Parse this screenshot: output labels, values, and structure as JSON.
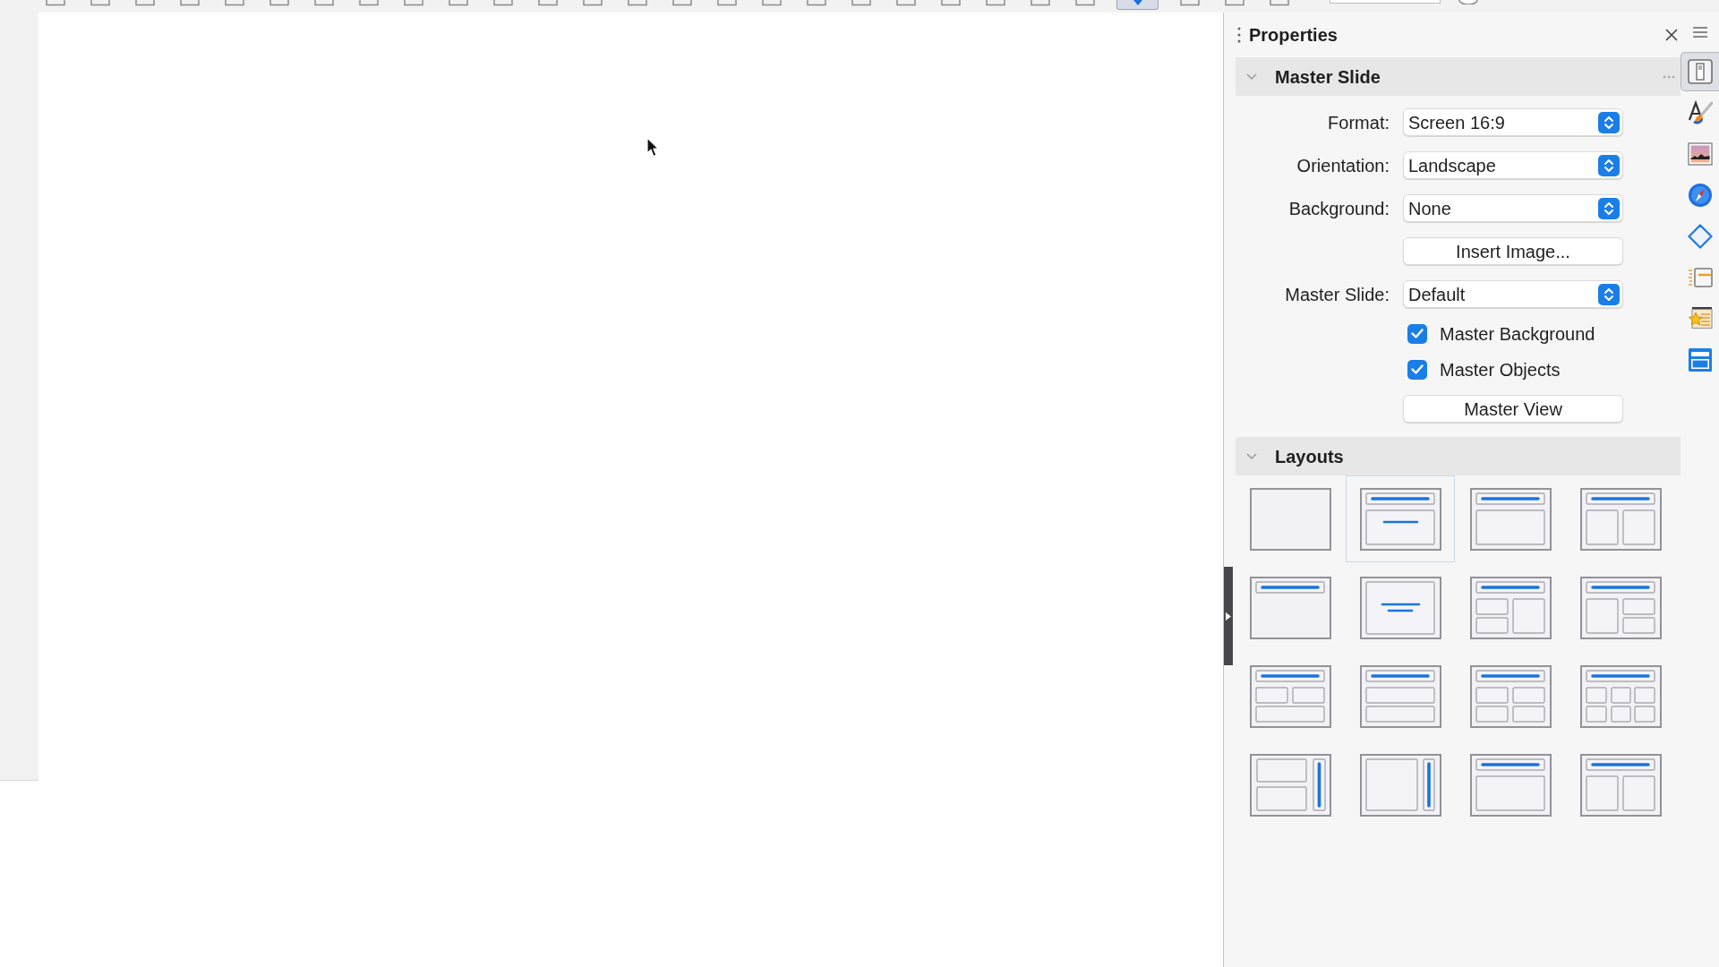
{
  "toolbar": {
    "items": [
      {
        "kind": "icon",
        "selected": false
      },
      {
        "kind": "icon",
        "selected": false
      },
      {
        "kind": "icon",
        "selected": false
      },
      {
        "kind": "icon",
        "selected": false
      },
      {
        "kind": "icon",
        "selected": false
      },
      {
        "kind": "icon",
        "selected": false
      },
      {
        "kind": "icon",
        "selected": false
      },
      {
        "kind": "icon",
        "selected": false
      },
      {
        "kind": "icon",
        "selected": false
      },
      {
        "kind": "icon",
        "selected": false
      },
      {
        "kind": "icon",
        "selected": false
      },
      {
        "kind": "icon",
        "selected": false
      },
      {
        "kind": "icon",
        "selected": false
      },
      {
        "kind": "icon",
        "selected": false
      },
      {
        "kind": "icon",
        "selected": false
      },
      {
        "kind": "icon",
        "selected": false
      },
      {
        "kind": "icon",
        "selected": false
      },
      {
        "kind": "icon",
        "selected": false
      },
      {
        "kind": "icon",
        "selected": false
      },
      {
        "kind": "icon",
        "selected": false
      },
      {
        "kind": "icon",
        "selected": false
      },
      {
        "kind": "icon",
        "selected": false
      },
      {
        "kind": "icon",
        "selected": false
      },
      {
        "kind": "icon",
        "selected": false
      },
      {
        "kind": "icon",
        "selected": true
      },
      {
        "kind": "icon",
        "selected": false
      },
      {
        "kind": "icon",
        "selected": false
      },
      {
        "kind": "icon",
        "selected": false
      },
      {
        "kind": "field"
      },
      {
        "kind": "knob"
      }
    ]
  },
  "sidebar": {
    "title": "Properties",
    "sections": [
      {
        "kind": "form",
        "title": "Master Slide",
        "expanded": true,
        "rows": [
          {
            "kind": "select",
            "label": "Format:",
            "value": "Screen 16:9"
          },
          {
            "kind": "select",
            "label": "Orientation:",
            "value": "Landscape"
          },
          {
            "kind": "select",
            "label": "Background:",
            "value": "None"
          },
          {
            "kind": "button",
            "label": "Insert Image..."
          },
          {
            "kind": "select",
            "label": "Master Slide:",
            "value": "Default"
          },
          {
            "kind": "checkbox",
            "label": "Master Background",
            "checked": true
          },
          {
            "kind": "checkbox",
            "label": "Master Objects",
            "checked": true
          },
          {
            "kind": "button",
            "label": "Master View"
          }
        ]
      },
      {
        "kind": "layouts",
        "title": "Layouts",
        "expanded": true,
        "layouts": [
          {
            "kind": "blank",
            "selected": false
          },
          {
            "kind": "title",
            "selected": true
          },
          {
            "kind": "content",
            "selected": false
          },
          {
            "kind": "twocontent",
            "selected": false
          },
          {
            "kind": "titleonly",
            "selected": false
          },
          {
            "kind": "centered",
            "selected": false
          },
          {
            "kind": "twoleft",
            "selected": false
          },
          {
            "kind": "tworight",
            "selected": false
          },
          {
            "kind": "twoover",
            "selected": false
          },
          {
            "kind": "stacked",
            "selected": false
          },
          {
            "kind": "four",
            "selected": false
          },
          {
            "kind": "six",
            "selected": false
          },
          {
            "kind": "verticalsplit",
            "selected": false
          },
          {
            "kind": "vertical",
            "selected": false
          },
          {
            "kind": "content",
            "selected": false
          },
          {
            "kind": "twocontent",
            "selected": false
          }
        ]
      }
    ]
  },
  "tab_bar": {
    "tabs": [
      {
        "kind": "properties",
        "selected": true
      },
      {
        "kind": "styles",
        "selected": false
      },
      {
        "kind": "gallery",
        "selected": false
      },
      {
        "kind": "navigator",
        "selected": false
      },
      {
        "kind": "shapes",
        "selected": false
      },
      {
        "kind": "transition",
        "selected": false
      },
      {
        "kind": "animation",
        "selected": false
      },
      {
        "kind": "masters",
        "selected": false
      }
    ]
  }
}
